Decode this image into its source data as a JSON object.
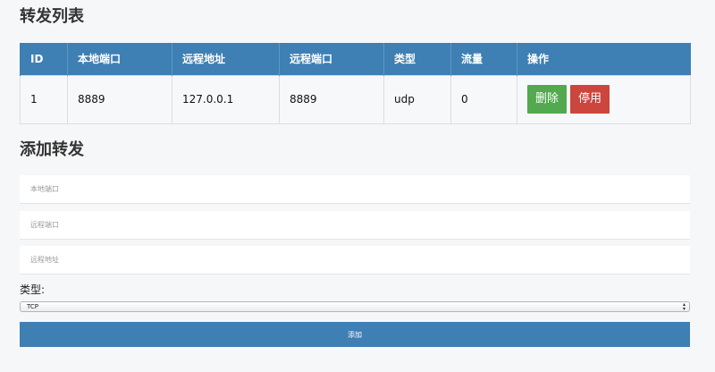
{
  "list_title": "转发列表",
  "table": {
    "headers": [
      "ID",
      "本地端口",
      "远程地址",
      "远程端口",
      "类型",
      "流量",
      "操作"
    ],
    "rows": [
      {
        "id": "1",
        "local_port": "8889",
        "remote_addr": "127.0.0.1",
        "remote_port": "8889",
        "type": "udp",
        "traffic": "0",
        "delete_label": "删除",
        "disable_label": "停用"
      }
    ]
  },
  "add_title": "添加转发",
  "form": {
    "local_port_placeholder": "本地端口",
    "remote_port_placeholder": "远程端口",
    "remote_addr_placeholder": "远程地址",
    "type_label": "类型:",
    "type_selected": "TCP",
    "submit_label": "添加"
  },
  "colors": {
    "primary": "#3e7fb4",
    "delete_button": "#52a94f",
    "disable_button": "#cc463e"
  }
}
